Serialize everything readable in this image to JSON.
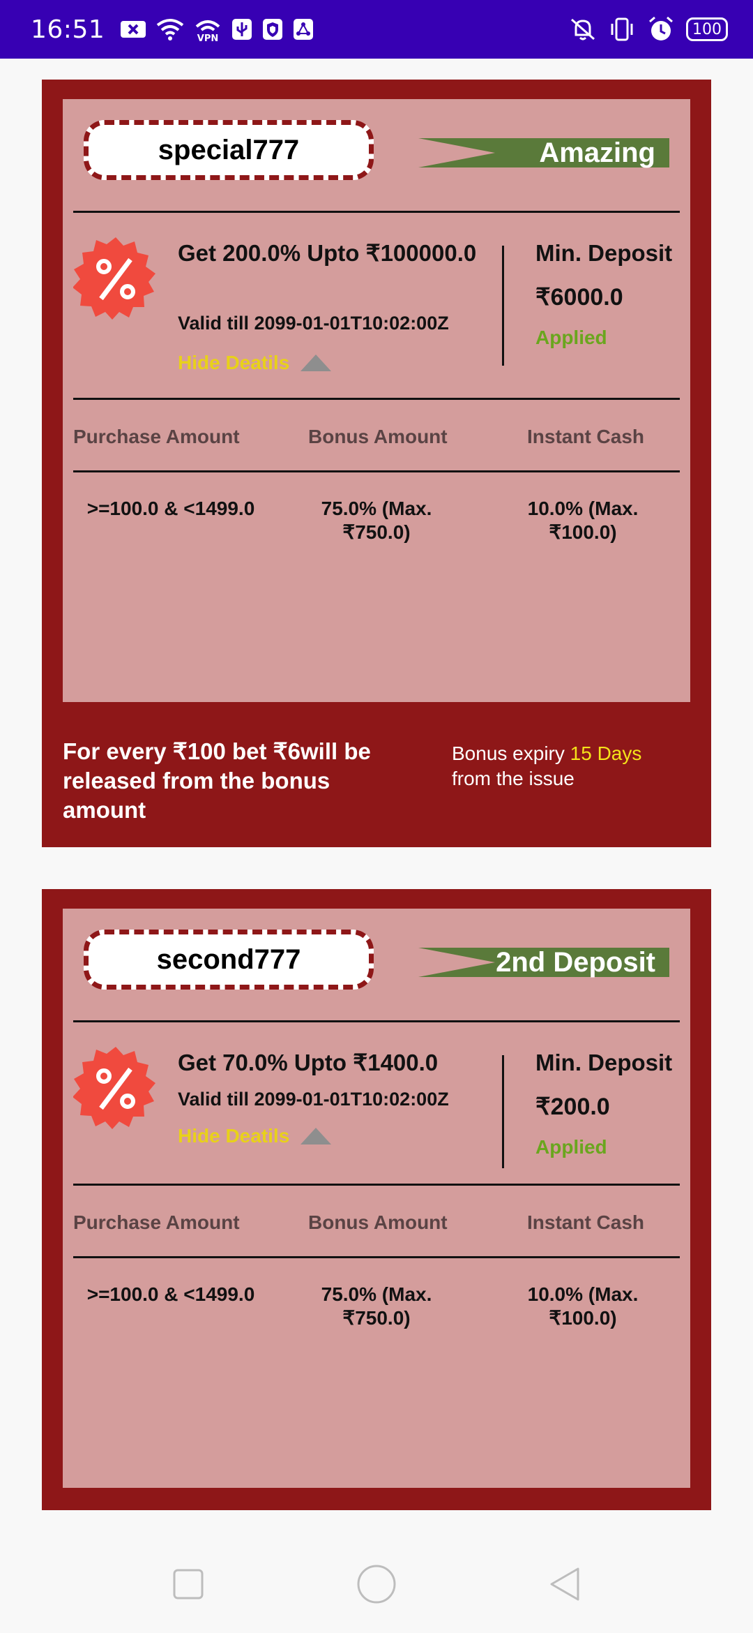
{
  "status_bar": {
    "time": "16:51",
    "battery": "100",
    "left_icons": [
      "x-icon",
      "wifi-icon",
      "vpn-icon",
      "usb-icon",
      "shield-icon",
      "share-icon"
    ],
    "right_icons": [
      "mute-icon",
      "vibrate-icon",
      "alarm-icon",
      "battery-icon"
    ],
    "bg_color": "#3700b3"
  },
  "cards": [
    {
      "code": "special777",
      "tag": "Amazing",
      "offer_title": "Get 200.0% Upto ₹100000.0",
      "valid": "Valid till 2099-01-01T10:02:00Z",
      "hide_label": "Hide Deatils",
      "min_deposit_label": "Min. Deposit",
      "min_deposit_value": "₹6000.0",
      "applied": "Applied",
      "table": {
        "headers": [
          "Purchase Amount",
          "Bonus Amount",
          "Instant Cash"
        ],
        "rows": [
          [
            ">=100.0 & <1499.0",
            "75.0% (Max. ₹750.0)",
            "10.0% (Max. ₹100.0)"
          ]
        ]
      },
      "footer_left": "For every ₹100 bet ₹6will be released from the  bonus amount",
      "footer_right_prefix": "Bonus expiry ",
      "footer_right_highlight": "15 Days",
      "footer_right_suffix": "from the issue"
    },
    {
      "code": "second777",
      "tag": "2nd Deposit",
      "offer_title": "Get 70.0% Upto ₹1400.0",
      "valid": "Valid till 2099-01-01T10:02:00Z",
      "hide_label": "Hide Deatils",
      "min_deposit_label": "Min. Deposit",
      "min_deposit_value": "₹200.0",
      "applied": "Applied",
      "table": {
        "headers": [
          "Purchase Amount",
          "Bonus Amount",
          "Instant Cash"
        ],
        "rows": [
          [
            ">=100.0 & <1499.0",
            "75.0% (Max. ₹750.0)",
            "10.0% (Max. ₹100.0)"
          ]
        ]
      }
    }
  ],
  "colors": {
    "card_outer": "#8e1718",
    "card_inner": "#d49d9c",
    "tag_green": "#5a7a3a",
    "badge_red": "#f04a3e",
    "hide_yellow": "#e8d11a",
    "applied_green": "#6aa61e"
  },
  "nav": [
    "recent-apps-icon",
    "home-icon",
    "back-icon"
  ]
}
